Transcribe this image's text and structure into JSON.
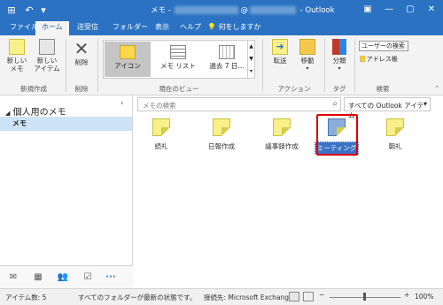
{
  "titlebar": {
    "title_prefix": "メモ -",
    "title_at": "@",
    "title_suffix": "- Outlook",
    "restore_glyph": "▢"
  },
  "tabs": [
    {
      "label": "ファイル"
    },
    {
      "label": "ホーム"
    },
    {
      "label": "送受信"
    },
    {
      "label": "フォルダー"
    },
    {
      "label": "表示"
    },
    {
      "label": "ヘルプ"
    }
  ],
  "tell_me": "何をしますか",
  "ribbon": {
    "new_note": "新しい\nメモ",
    "new_items": "新しい\nアイテム",
    "delete": "削除",
    "new_group": "新規作成",
    "delete_group": "削除",
    "views": [
      "アイコン",
      "メモ リスト",
      "過去 7 日..."
    ],
    "view_group": "現在のビュー",
    "forward": "転送",
    "move": "移動",
    "action_group": "アクション",
    "categorize": "分類",
    "tags_group": "タグ",
    "search_people": "ユーザーの検索",
    "address_book": "アドレス帳",
    "find_group": "検索"
  },
  "nav": {
    "section": "個人用のメモ",
    "selected_folder": "メモ"
  },
  "search": {
    "placeholder": "メモの検索",
    "scope": "すべての Outlook アイテム"
  },
  "notes": [
    {
      "label": "続礼"
    },
    {
      "label": "日報作成"
    },
    {
      "label": "議事録作成"
    },
    {
      "label": "ミーティング"
    },
    {
      "label": "朝礼"
    }
  ],
  "status": {
    "count": "アイテム数: 5",
    "state": "すべてのフォルダーが最新の状態です。",
    "connection": "接続先: Microsoft Exchange",
    "zoom": "100%"
  },
  "colors": {
    "accent": "#2b72c2",
    "note_yellow": "#f9f08a",
    "highlight": "#e00000"
  }
}
